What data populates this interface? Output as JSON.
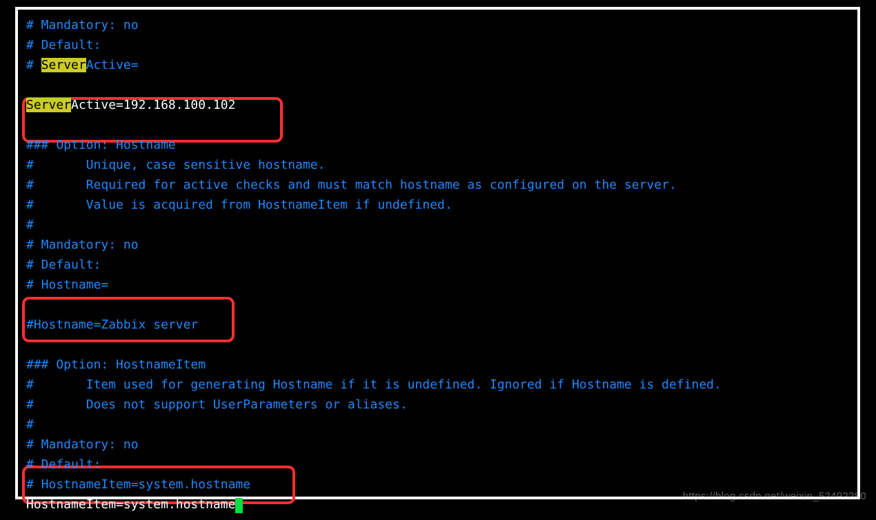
{
  "config": {
    "l1a": "# Mandatory: no",
    "l2a": "# Default:",
    "l3_hash": "# ",
    "l3_hl": "Server",
    "l3_rest": "Active=",
    "l5_hl": "Server",
    "l5_white": "Active=192.168.100.102",
    "l7": "### Option: Hostname",
    "l8": "#       Unique, case sensitive hostname.",
    "l9": "#       Required for active checks and must match hostname as configured on the server.",
    "l10": "#       Value is acquired from HostnameItem if undefined.",
    "l11": "#",
    "l12": "# Mandatory: no",
    "l13": "# Default:",
    "l14": "# Hostname=",
    "l16": "#Hostname=Zabbix server",
    "l18": "### Option: HostnameItem",
    "l19": "#       Item used for generating Hostname if it is undefined. Ignored if Hostname is defined.",
    "l20": "#       Does not support UserParameters or aliases.",
    "l21": "#",
    "l22": "# Mandatory: no",
    "l23": "# Default:",
    "l24": "# HostnameItem=system.hostname",
    "l25_white": "HostnameItem=system.hostname"
  },
  "watermark": "https://blog.csdn.net/weixin_52492280"
}
